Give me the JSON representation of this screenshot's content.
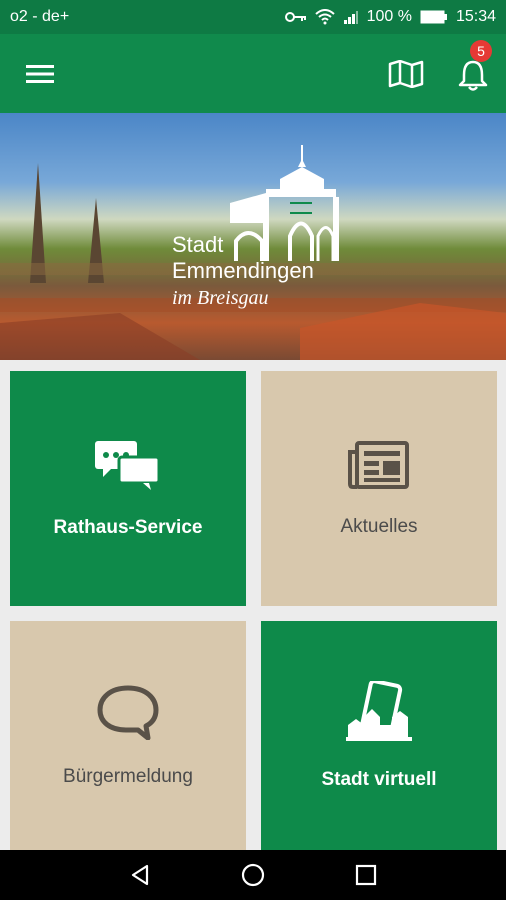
{
  "status_bar": {
    "carrier": "o2 - de+",
    "battery": "100 %",
    "time": "15:34"
  },
  "app_bar": {
    "notification_count": "5"
  },
  "hero": {
    "logo_line1": "Stadt",
    "logo_line2": "Emmendingen",
    "logo_line3": "im Breisgau"
  },
  "tiles": [
    {
      "label": "Rathaus-Service",
      "icon": "chat-bubbles-icon",
      "color": "#0e8a4a"
    },
    {
      "label": "Aktuelles",
      "icon": "newspaper-icon",
      "color": "#d8c8ad"
    },
    {
      "label": "Bürgermeldung",
      "icon": "speech-bubble-icon",
      "color": "#d8c8ad"
    },
    {
      "label": "Stadt virtuell",
      "icon": "virtual-city-icon",
      "color": "#0e8a4a"
    }
  ],
  "colors": {
    "primary": "#108a4c",
    "beige": "#d8c8ad",
    "badge": "#e53935"
  }
}
